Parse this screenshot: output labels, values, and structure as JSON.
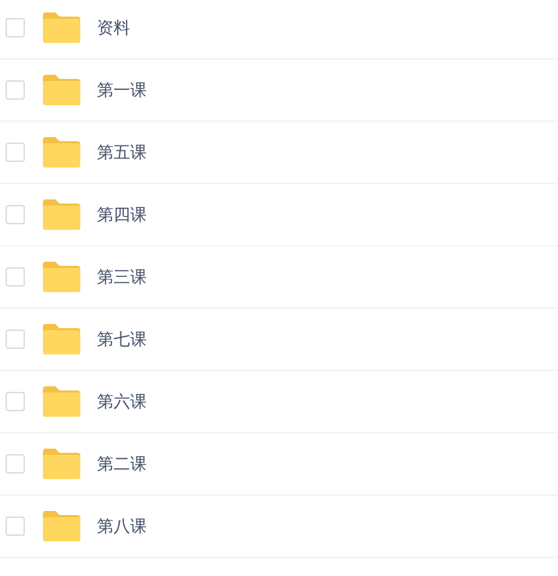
{
  "files": [
    {
      "name": "资料",
      "checked": false
    },
    {
      "name": "第一课",
      "checked": false
    },
    {
      "name": "第五课",
      "checked": false
    },
    {
      "name": "第四课",
      "checked": false
    },
    {
      "name": "第三课",
      "checked": false
    },
    {
      "name": "第七课",
      "checked": false
    },
    {
      "name": "第六课",
      "checked": false
    },
    {
      "name": "第二课",
      "checked": false
    },
    {
      "name": "第八课",
      "checked": false
    }
  ]
}
